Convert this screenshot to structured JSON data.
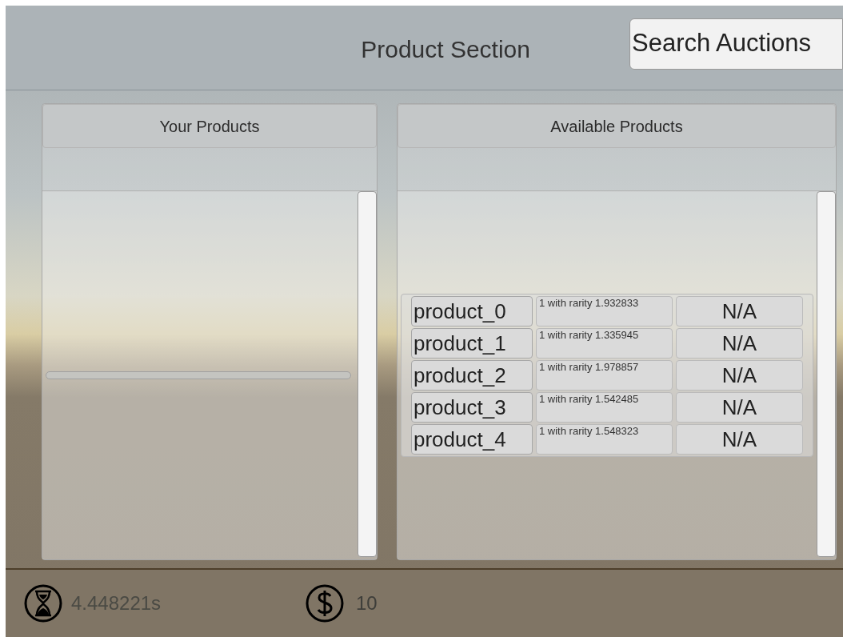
{
  "header": {
    "title": "Product Section",
    "search_button": "Search Auctions"
  },
  "panels": [
    {
      "title": "Your Products"
    },
    {
      "title": "Available Products",
      "items": [
        {
          "name": "product_0",
          "detail": "1 with rarity 1.932833",
          "price": "N/A"
        },
        {
          "name": "product_1",
          "detail": "1 with rarity 1.335945",
          "price": "N/A"
        },
        {
          "name": "product_2",
          "detail": "1 with rarity 1.978857",
          "price": "N/A"
        },
        {
          "name": "product_3",
          "detail": "1 with rarity 1.542485",
          "price": "N/A"
        },
        {
          "name": "product_4",
          "detail": "1 with rarity 1.548323",
          "price": "N/A"
        }
      ]
    }
  ],
  "status_bar": {
    "time": "4.448221s",
    "money": "10"
  }
}
